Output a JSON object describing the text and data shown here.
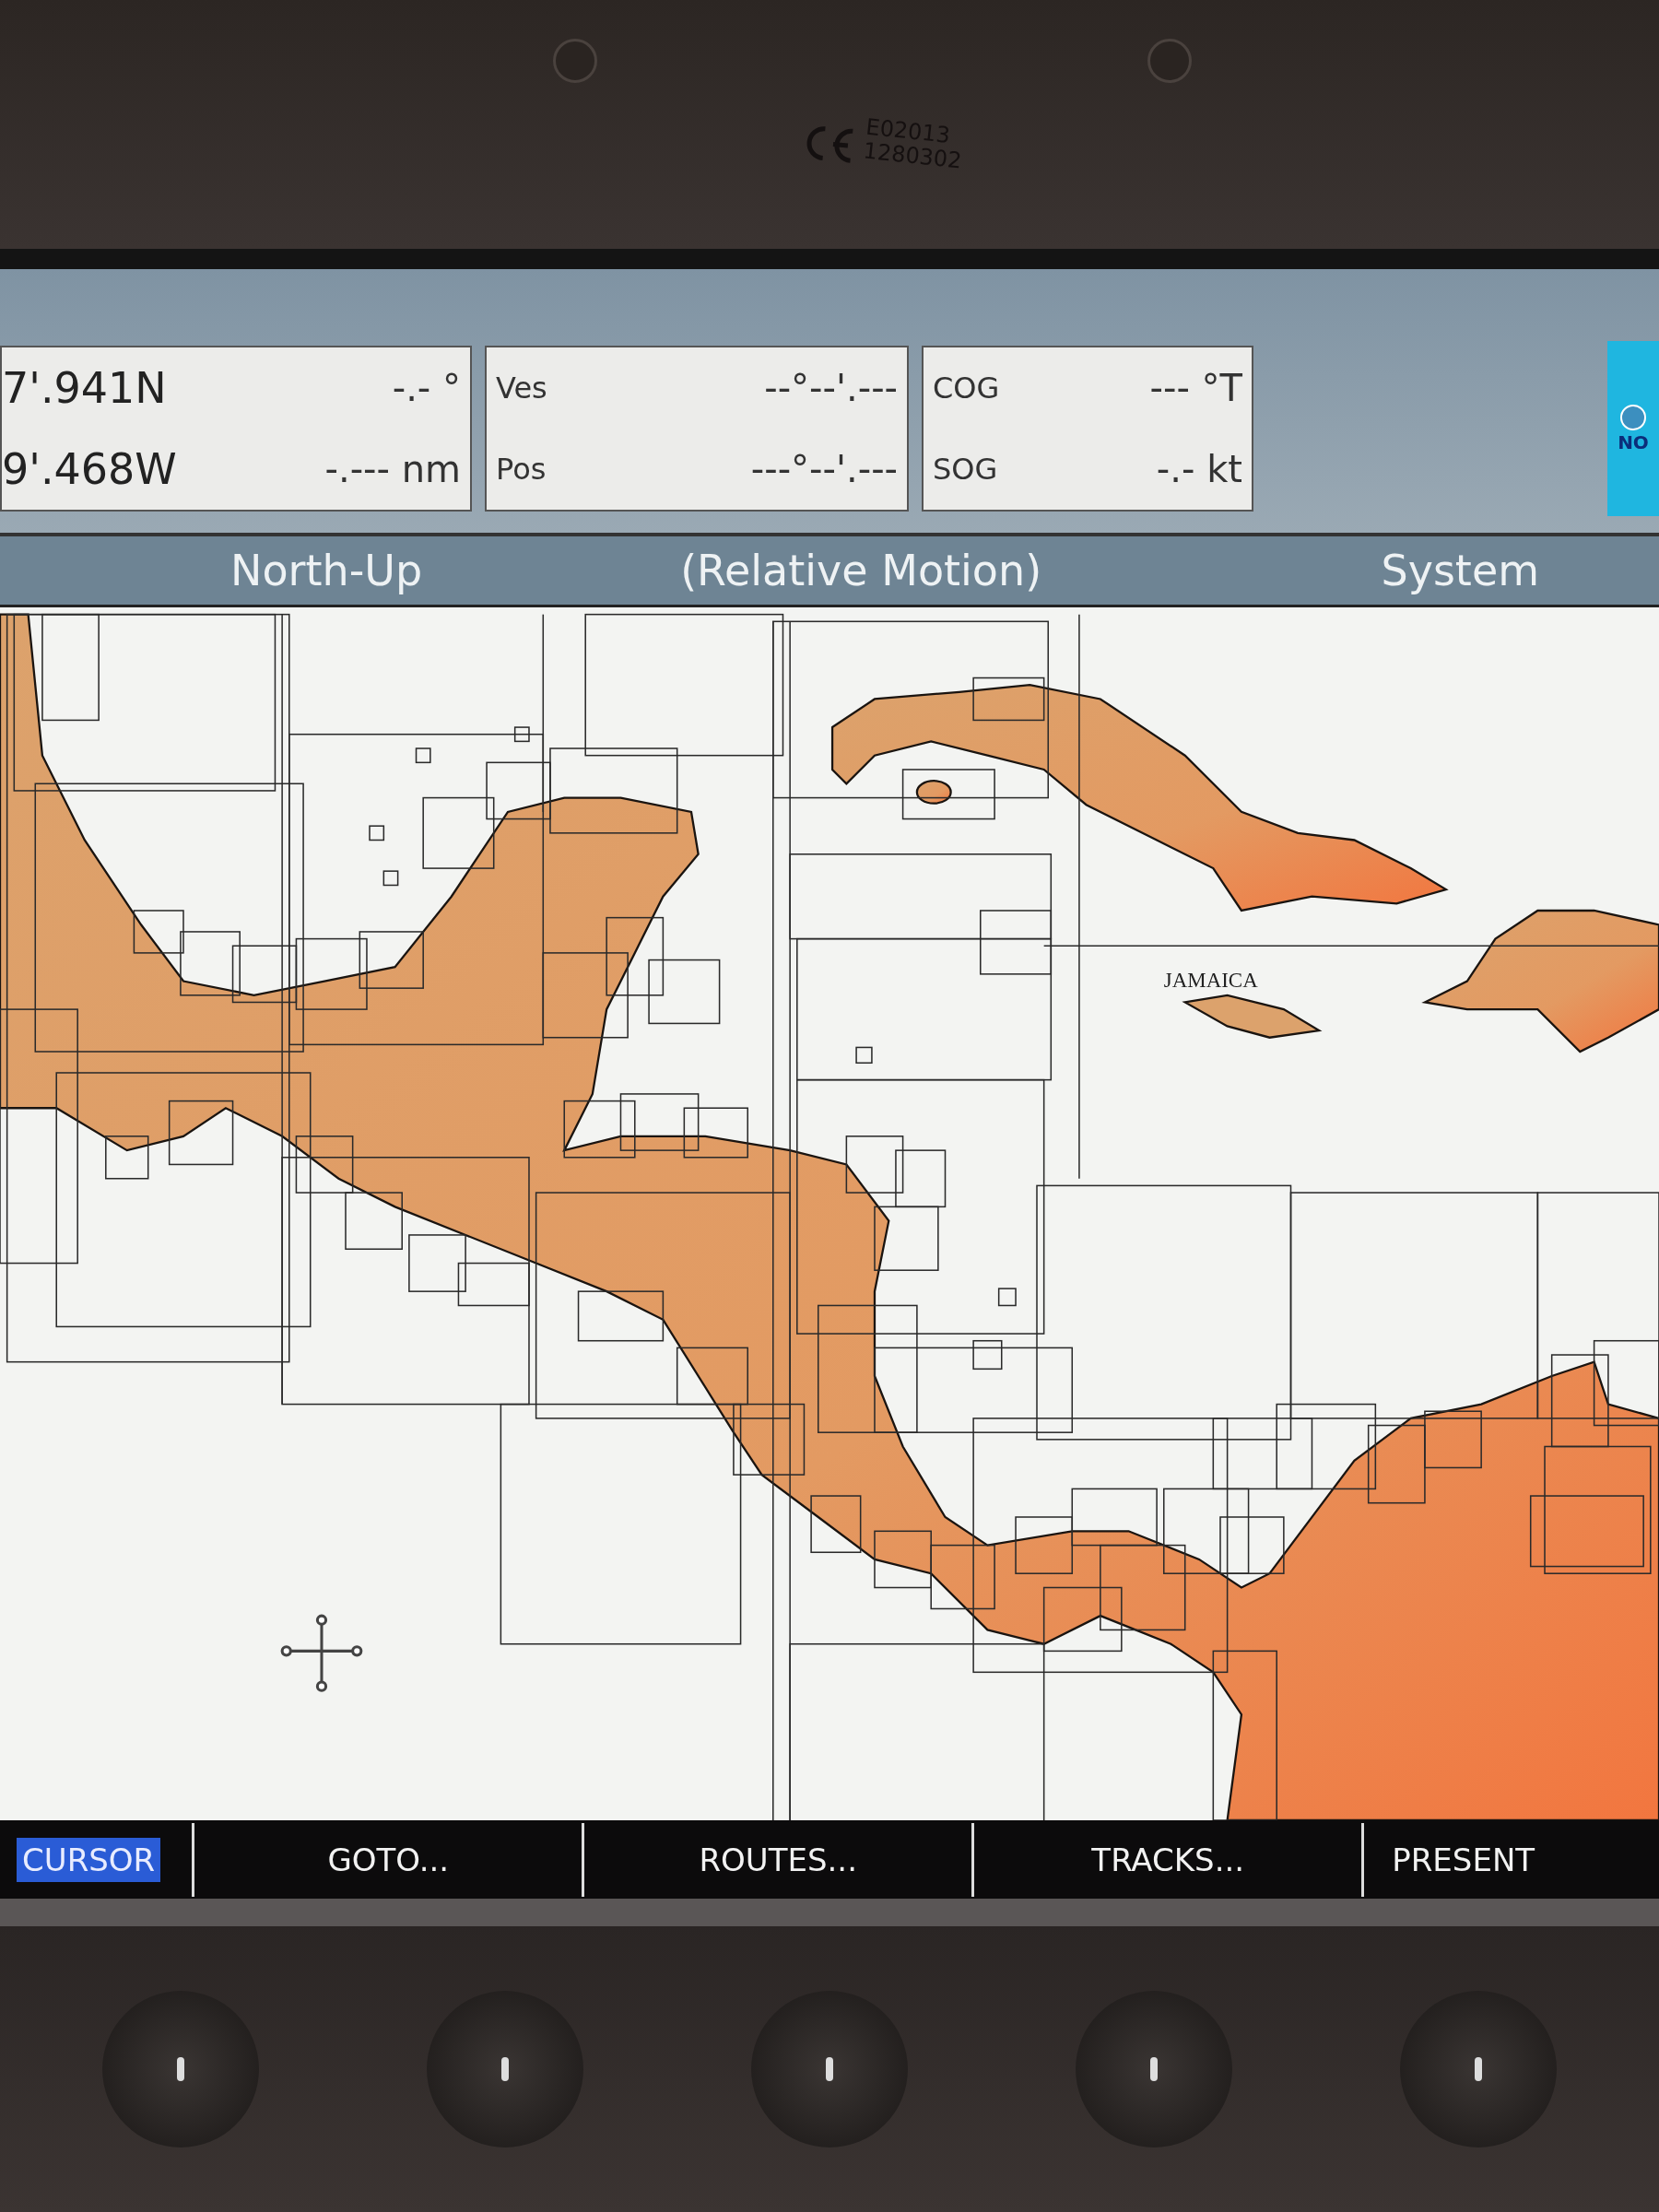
{
  "bezel": {
    "marking_code": "E02013",
    "serial": "1280302"
  },
  "data_panels": [
    {
      "rows": [
        {
          "label": "7'.941N",
          "reading": "-.- °"
        },
        {
          "label": "9'.468W",
          "reading": "-.--- nm"
        }
      ]
    },
    {
      "rows": [
        {
          "label": "Ves",
          "reading": "--°--'.---"
        },
        {
          "label": "Pos",
          "reading": "---°--'.---"
        }
      ]
    },
    {
      "rows": [
        {
          "label": "COG",
          "reading": "--- °T"
        },
        {
          "label": "SOG",
          "reading": "-.- kt"
        }
      ]
    }
  ],
  "status_badge": {
    "text": "NO"
  },
  "header": {
    "orientation": "North-Up",
    "motion_mode": "(Relative Motion)",
    "menu": "System"
  },
  "map": {
    "labels": [
      "JAMAICA"
    ]
  },
  "softkeys": [
    {
      "label": "CURSOR",
      "selected": true
    },
    {
      "label": "GOTO...",
      "selected": false
    },
    {
      "label": "ROUTES...",
      "selected": false
    },
    {
      "label": "TRACKS...",
      "selected": false
    },
    {
      "label": "PRESENT",
      "selected": false
    }
  ]
}
